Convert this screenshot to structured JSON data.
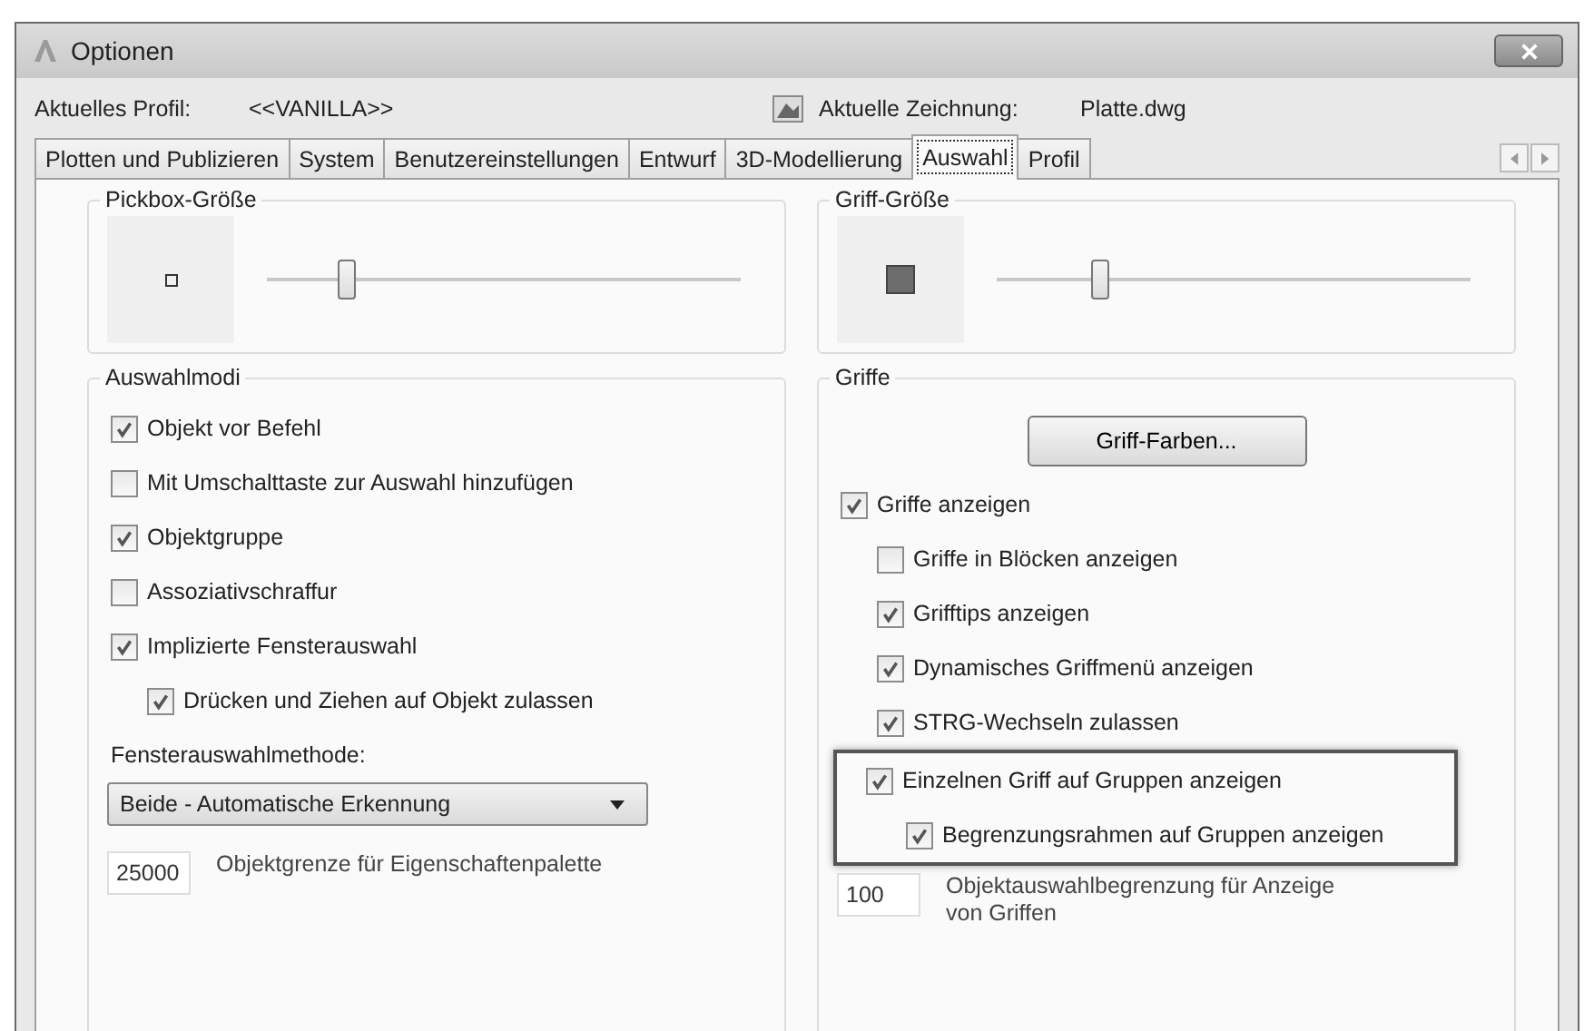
{
  "window": {
    "title": "Optionen"
  },
  "profile": {
    "label": "Aktuelles Profil:",
    "value": "<<VANILLA>>"
  },
  "drawing": {
    "label": "Aktuelle Zeichnung:",
    "value": "Platte.dwg"
  },
  "tabs": [
    {
      "label": "Plotten und Publizieren",
      "selected": false
    },
    {
      "label": "System",
      "selected": false
    },
    {
      "label": "Benutzereinstellungen",
      "selected": false
    },
    {
      "label": "Entwurf",
      "selected": false
    },
    {
      "label": "3D-Modellierung",
      "selected": false
    },
    {
      "label": "Auswahl",
      "selected": true
    },
    {
      "label": "Profil",
      "selected": false
    }
  ],
  "pickbox_size": {
    "title": "Pickbox-Größe",
    "level": 0.17
  },
  "selection_modes": {
    "title": "Auswahlmodi",
    "options": [
      {
        "label": "Objekt vor Befehl",
        "checked": true
      },
      {
        "label": "Mit Umschalttaste zur Auswahl hinzufügen",
        "checked": false
      },
      {
        "label": "Objektgruppe",
        "checked": true
      },
      {
        "label": "Assoziativschraffur",
        "checked": false
      },
      {
        "label": "Implizierte Fensterauswahl",
        "checked": true,
        "children": [
          {
            "label": "Drücken und Ziehen auf Objekt zulassen",
            "checked": true
          }
        ]
      }
    ],
    "window_method": {
      "label": "Fensterauswahlmethode:",
      "value": "Beide - Automatische Erkennung"
    },
    "object_limit": {
      "value": "25000",
      "label": "Objektgrenze für Eigenschaftenpalette"
    }
  },
  "grip_size": {
    "title": "Griff-Größe",
    "level": 0.22
  },
  "grips": {
    "title": "Griffe",
    "button": "Griff-Farben...",
    "options": [
      {
        "label": "Griffe anzeigen",
        "checked": true,
        "children": [
          {
            "label": "Griffe in Blöcken anzeigen",
            "checked": false
          },
          {
            "label": "Grifftips anzeigen",
            "checked": true
          },
          {
            "label": "Dynamisches Griffmenü anzeigen",
            "checked": true
          },
          {
            "label": "STRG-Wechseln zulassen",
            "checked": true
          },
          {
            "label": "Einzelnen Griff auf Gruppen anzeigen",
            "checked": true,
            "highlighted": true,
            "children": [
              {
                "label": "Begrenzungsrahmen auf Gruppen anzeigen",
                "checked": true
              }
            ]
          }
        ]
      }
    ],
    "grip_limit": {
      "value": "100",
      "label": "Objektauswahlbegrenzung für Anzeige von Griffen"
    }
  }
}
